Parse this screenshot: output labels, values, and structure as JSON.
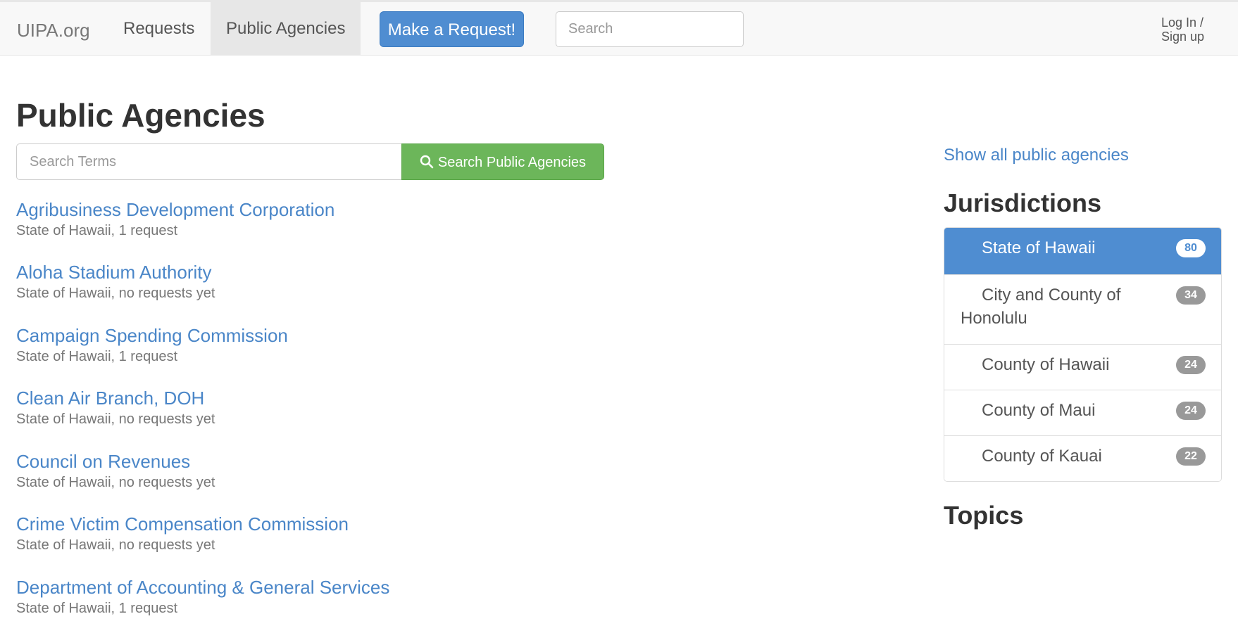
{
  "navbar": {
    "brand": "UIPA.org",
    "links": [
      {
        "label": "Requests",
        "active": false
      },
      {
        "label": "Public Agencies",
        "active": true
      }
    ],
    "make_request_label": "Make a Request!",
    "search_placeholder": "Search",
    "login_label": "Log In / Sign up"
  },
  "main": {
    "title": "Public Agencies",
    "search_placeholder": "Search Terms",
    "search_button_label": "Search Public Agencies",
    "agencies": [
      {
        "name": "Agribusiness Development Corporation",
        "meta": "State of Hawaii, 1 request"
      },
      {
        "name": "Aloha Stadium Authority",
        "meta": "State of Hawaii, no requests yet"
      },
      {
        "name": "Campaign Spending Commission",
        "meta": "State of Hawaii, 1 request"
      },
      {
        "name": "Clean Air Branch, DOH",
        "meta": "State of Hawaii, no requests yet"
      },
      {
        "name": "Council on Revenues",
        "meta": "State of Hawaii, no requests yet"
      },
      {
        "name": "Crime Victim Compensation Commission",
        "meta": "State of Hawaii, no requests yet"
      },
      {
        "name": "Department of Accounting & General Services",
        "meta": "State of Hawaii, 1 request"
      }
    ]
  },
  "sidebar": {
    "show_all_label": "Show all public agencies",
    "jurisdictions_heading": "Jurisdictions",
    "jurisdictions": [
      {
        "name": "State of Hawaii",
        "count": "80",
        "active": true
      },
      {
        "name": "City and County of Honolulu",
        "count": "34",
        "active": false
      },
      {
        "name": "County of Hawaii",
        "count": "24",
        "active": false
      },
      {
        "name": "County of Maui",
        "count": "24",
        "active": false
      },
      {
        "name": "County of Kauai",
        "count": "22",
        "active": false
      }
    ],
    "topics_heading": "Topics"
  },
  "colors": {
    "link": "#4a86c8",
    "primary": "#4f8dd1",
    "success": "#6cb65a",
    "badge": "#999999",
    "muted_text": "#777777"
  },
  "icons": {
    "search_button_icon": "search-icon"
  }
}
